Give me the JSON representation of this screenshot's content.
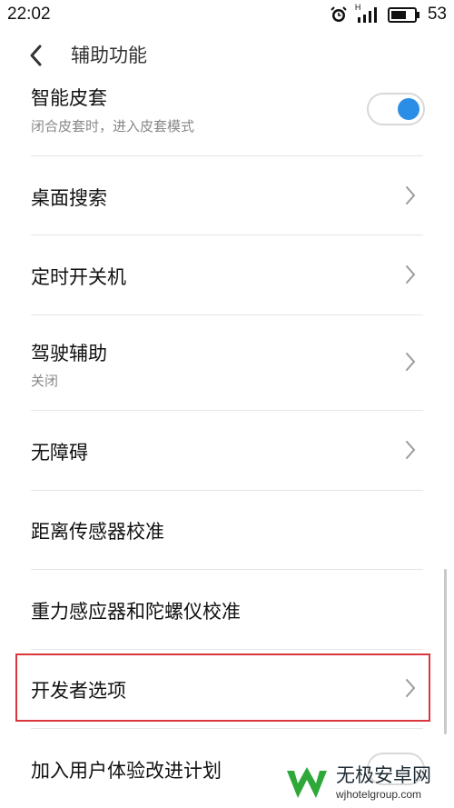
{
  "status_bar": {
    "time": "22:02",
    "network": "H",
    "battery": "53",
    "icons": [
      "alarm-icon",
      "signal-icon",
      "battery-icon"
    ]
  },
  "header": {
    "title": "辅助功能",
    "back_icon": "chevron-left-icon"
  },
  "settings": [
    {
      "label": "智能皮套",
      "subtitle": "闭合皮套时，进入皮套模式",
      "control": "toggle",
      "toggle_on": true
    },
    {
      "label": "桌面搜索",
      "control": "chevron"
    },
    {
      "label": "定时开关机",
      "control": "chevron"
    },
    {
      "label": "驾驶辅助",
      "subtitle": "关闭",
      "control": "chevron"
    },
    {
      "label": "无障碍",
      "control": "chevron"
    },
    {
      "label": "距离传感器校准",
      "control": "none"
    },
    {
      "label": "重力感应器和陀螺仪校准",
      "control": "none"
    },
    {
      "label": "开发者选项",
      "control": "chevron",
      "highlighted": true
    },
    {
      "label": "加入用户体验改进计划",
      "control": "toggle",
      "toggle_on": false
    }
  ],
  "colors": {
    "accent": "#2a8de6",
    "highlight_border": "#d9363e",
    "watermark_green": "#2fa83a"
  },
  "watermark": {
    "name": "无极安卓网",
    "url": "wjhotelgroup.com"
  }
}
